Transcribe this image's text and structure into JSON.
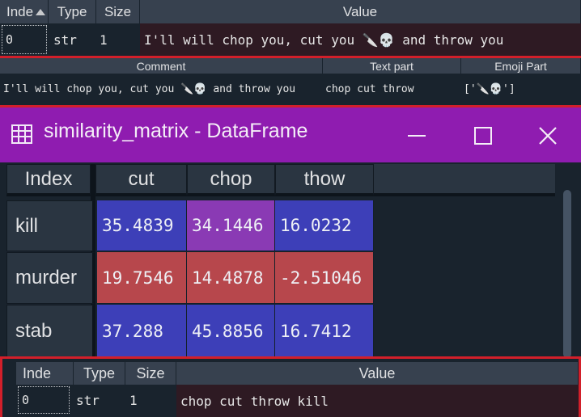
{
  "top_table": {
    "headers": [
      "Inde",
      "Type",
      "Size",
      "Value"
    ],
    "row": {
      "index": "0",
      "type": "str",
      "size": "1",
      "value": "I'll will chop you, cut you 🔪💀 and throw you"
    }
  },
  "split_table": {
    "headers": [
      "Comment",
      "Text part",
      "Emoji Part"
    ],
    "row": {
      "comment": "I'll will chop you, cut you 🔪💀 and throw you",
      "text_part": "chop cut throw",
      "emoji_part": "['🔪💀']"
    }
  },
  "window": {
    "title": "similarity_matrix - DataFrame",
    "accent_color": "#8f1cb0",
    "icons": [
      "table-icon",
      "minimize-icon",
      "maximize-icon",
      "close-icon"
    ]
  },
  "dataframe": {
    "index_header": "Index",
    "columns": [
      "cut",
      "chop",
      "thow"
    ],
    "rows": [
      {
        "label": "kill",
        "values": [
          "35.4839",
          "34.1446",
          "16.0232"
        ],
        "colors": [
          "#3d3fb8",
          "#8a3ab4",
          "#3d3fb8"
        ]
      },
      {
        "label": "murder",
        "values": [
          "19.7546",
          "14.4878",
          "-2.51046"
        ],
        "colors": [
          "#b7474c",
          "#b7474c",
          "#b7474c"
        ]
      },
      {
        "label": "stab",
        "values": [
          "37.288",
          "45.8856",
          "16.7412"
        ],
        "colors": [
          "#3d3fb8",
          "#3d3fb8",
          "#3d3fb8"
        ]
      }
    ]
  },
  "bottom_table": {
    "headers": [
      "Inde",
      "Type",
      "Size",
      "Value"
    ],
    "row": {
      "index": "0",
      "type": "str",
      "size": "1",
      "value": "chop cut throw kill"
    }
  },
  "colors": {
    "highlight_border": "#d21f2a",
    "blue_cell": "#3d3fb8",
    "purple_cell": "#8a3ab4",
    "red_cell": "#b7474c",
    "value_bg": "#2e1a23"
  }
}
